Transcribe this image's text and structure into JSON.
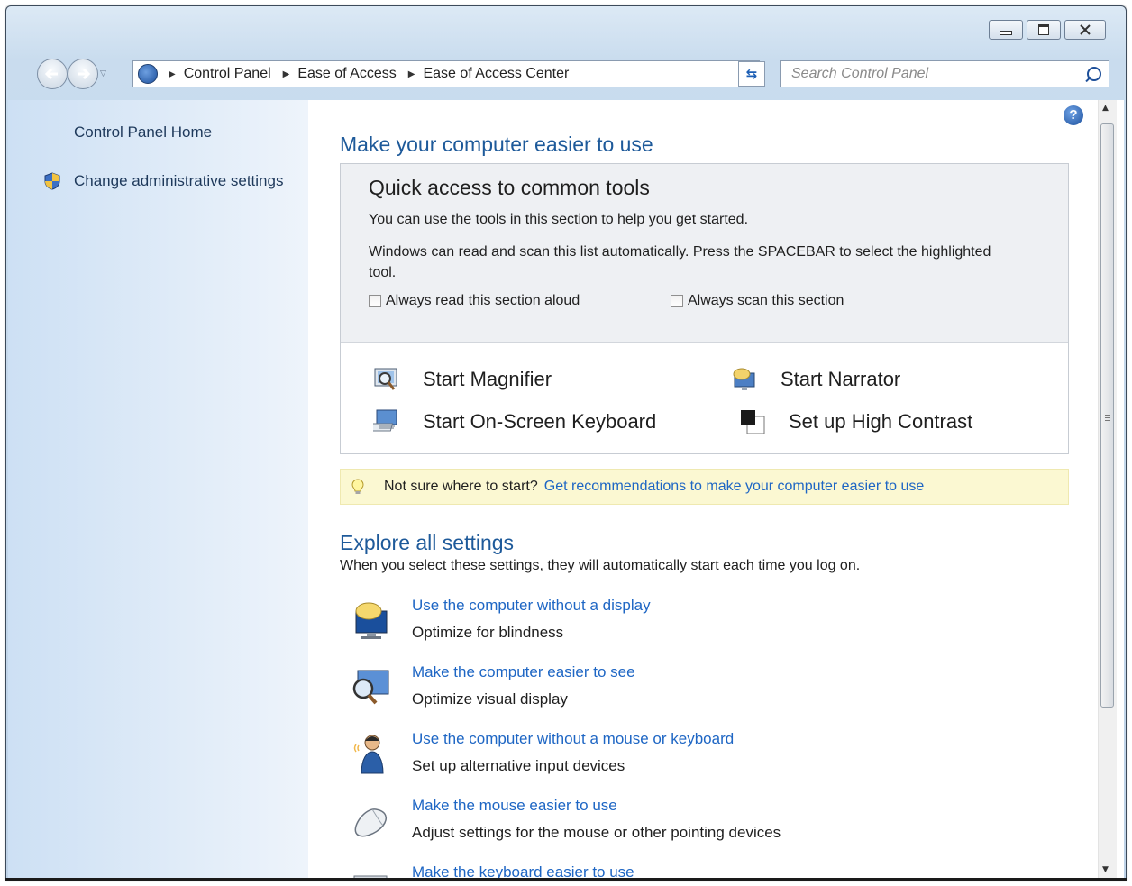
{
  "window": {
    "buttons": {
      "minimize": "minimize",
      "maximize": "maximize",
      "close": "close"
    }
  },
  "nav": {
    "breadcrumbs": [
      "Control Panel",
      "Ease of Access",
      "Ease of Access Center"
    ],
    "search_placeholder": "Search Control Panel"
  },
  "sidebar": {
    "home": "Control Panel Home",
    "admin": "Change administrative settings"
  },
  "main": {
    "title": "Make your computer easier to use",
    "quick": {
      "title": "Quick access to common tools",
      "line1": "You can use the tools in this section to help you get started.",
      "line2": "Windows can read and scan this list automatically.  Press the SPACEBAR to select the highlighted tool.",
      "check_read": "Always read this section aloud",
      "check_scan": "Always scan this section",
      "tools": {
        "magnifier": "Start Magnifier",
        "narrator": "Start Narrator",
        "keyboard": "Start On-Screen Keyboard",
        "contrast": "Set up High Contrast"
      }
    },
    "tip": {
      "question": "Not sure where to start?",
      "link": "Get recommendations to make your computer easier to use"
    },
    "explore": {
      "title": "Explore all settings",
      "subtitle": "When you select these settings, they will automatically start each time you log on.",
      "items": [
        {
          "link": "Use the computer without a display",
          "desc": "Optimize for blindness",
          "icon": "display-speech-icon"
        },
        {
          "link": "Make the computer easier to see",
          "desc": "Optimize visual display",
          "icon": "magnifier-monitor-icon"
        },
        {
          "link": "Use the computer without a mouse or keyboard",
          "desc": "Set up alternative input devices",
          "icon": "person-speaking-icon"
        },
        {
          "link": "Make the mouse easier to use",
          "desc": "Adjust settings for the mouse or other pointing devices",
          "icon": "mouse-icon"
        },
        {
          "link": "Make the keyboard easier to use",
          "desc": "",
          "icon": "keyboard-icon"
        }
      ]
    }
  },
  "colors": {
    "link": "#1e66c4",
    "heading": "#1e5a9a",
    "tip_bg": "#fbf8d2"
  }
}
